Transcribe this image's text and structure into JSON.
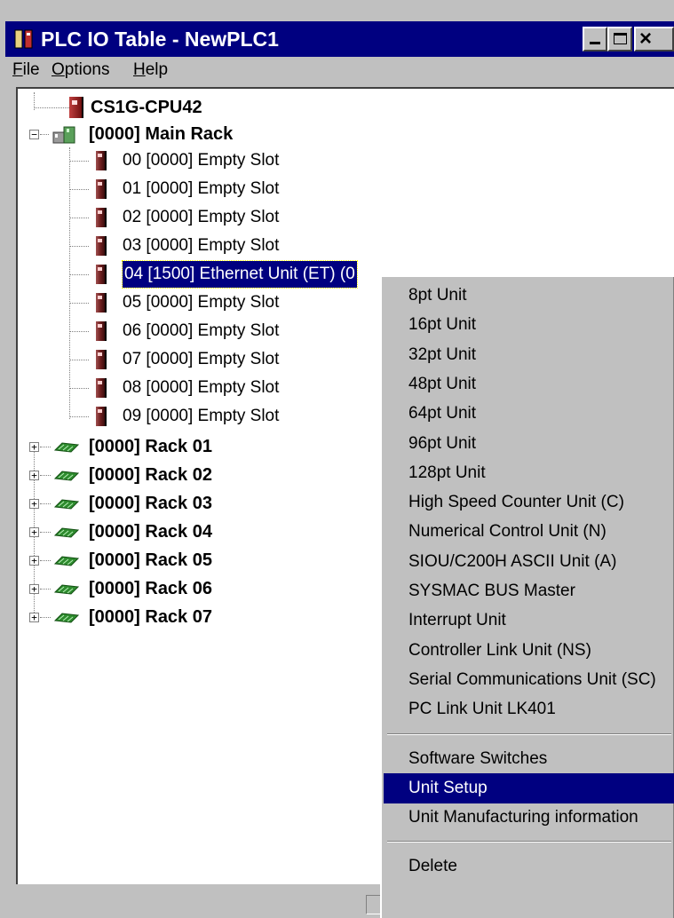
{
  "window": {
    "title": "PLC IO Table - NewPLC1",
    "min_glyph": "",
    "max_glyph": "",
    "close_glyph": "×"
  },
  "menu": {
    "file": {
      "first": "F",
      "rest": "ile"
    },
    "options": {
      "first": "O",
      "rest": "ptions"
    },
    "help": {
      "first": "H",
      "rest": "elp"
    }
  },
  "tree": {
    "cpu": "CS1G-CPU42",
    "main_rack": "[0000] Main Rack",
    "slots": [
      "00 [0000] Empty Slot",
      "01 [0000] Empty Slot",
      "02 [0000] Empty Slot",
      "03 [0000] Empty Slot",
      "04 [1500] Ethernet Unit (ET) (0",
      "05 [0000] Empty Slot",
      "06 [0000] Empty Slot",
      "07 [0000] Empty Slot",
      "08 [0000] Empty Slot",
      "09 [0000] Empty Slot"
    ],
    "selected_slot_index": 4,
    "racks": [
      "[0000] Rack 01",
      "[0000] Rack 02",
      "[0000] Rack 03",
      "[0000] Rack 04",
      "[0000] Rack 05",
      "[0000] Rack 06",
      "[0000] Rack 07"
    ],
    "expand_plus": "+",
    "expand_minus": "−"
  },
  "context_menu": {
    "group1": [
      "8pt Unit",
      "16pt Unit",
      "32pt Unit",
      "48pt Unit",
      "64pt Unit",
      "96pt Unit",
      "128pt Unit",
      "High Speed Counter Unit (C)",
      "Numerical Control Unit (N)",
      "SIOU/C200H ASCII Unit (A)",
      "SYSMAC BUS Master",
      "Interrupt Unit",
      "Controller Link Unit (NS)",
      "Serial Communications Unit (SC)",
      "PC Link Unit LK401"
    ],
    "group2": [
      "Software Switches",
      "Unit Setup",
      "Unit Manufacturing information"
    ],
    "group3": [
      "Delete"
    ],
    "highlighted": "Unit Setup"
  },
  "colors": {
    "titlebar": "#000080",
    "highlight": "#000080",
    "face": "#c0c0c0",
    "rack_green": "#2e8b2e"
  }
}
